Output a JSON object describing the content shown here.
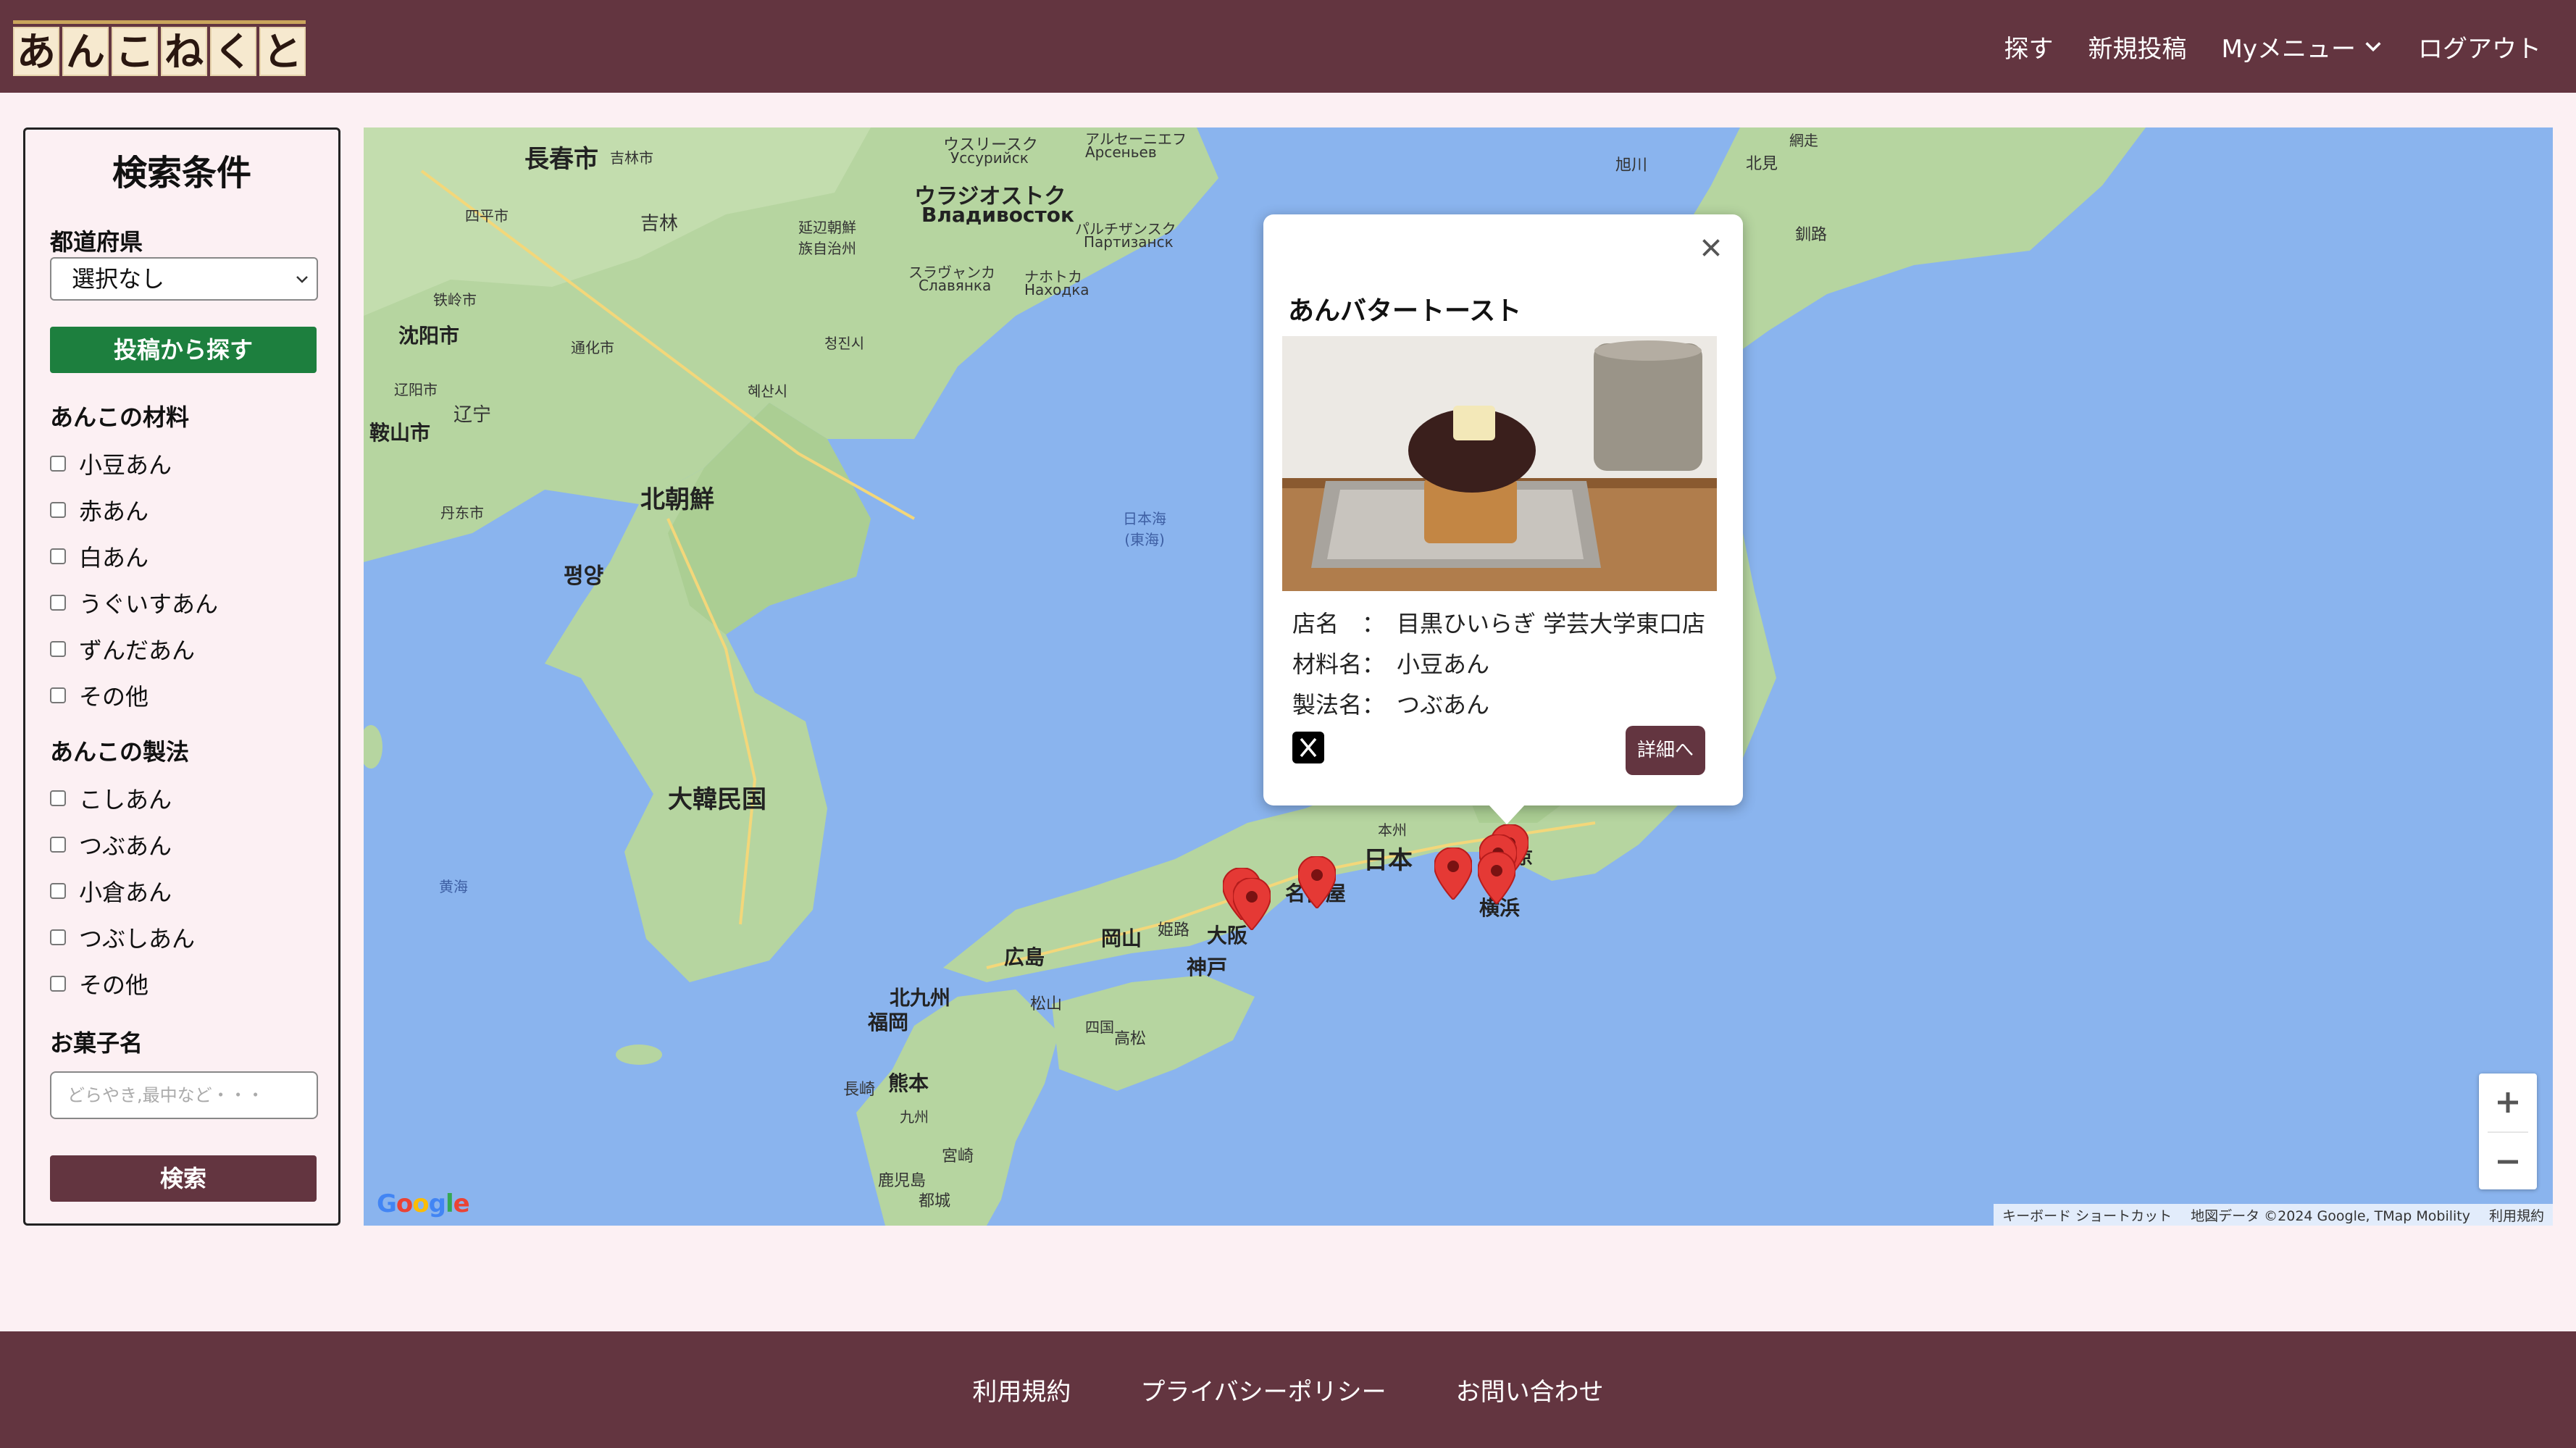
{
  "header": {
    "logo_chars": [
      "あ",
      "ん",
      "こ",
      "ね",
      "く",
      "と"
    ],
    "nav": {
      "search": "探す",
      "new_post": "新規投稿",
      "my_menu": "Myメニュー",
      "logout": "ログアウト"
    }
  },
  "sidebar": {
    "title": "検索条件",
    "prefecture_label": "都道府県",
    "prefecture_value": "選択なし",
    "search_from_posts": "投稿から探す",
    "material_label": "あんこの材料",
    "materials": [
      "小豆あん",
      "赤あん",
      "白あん",
      "うぐいすあん",
      "ずんだあん",
      "その他"
    ],
    "method_label": "あんこの製法",
    "methods": [
      "こしあん",
      "つぶあん",
      "小倉あん",
      "つぶしあん",
      "その他"
    ],
    "sweets_label": "お菓子名",
    "sweets_placeholder": "どらやき,最中など・・・",
    "search_button": "検索"
  },
  "map": {
    "labels": {
      "changchun": "長春市",
      "jilin_city": "吉林市",
      "ussuriysk": "ウスリースク",
      "ussuriysk_ru": "Уссурийск",
      "arsenyev": "アルセーニエフ",
      "arsenyev_ru": "Арсеньев",
      "vladivostok": "ウラジオストク",
      "vladivostok_ru": "Владивосток",
      "partizansk": "パルチザンスク",
      "partizansk_ru": "Партизанск",
      "yanbian": "延辺朝鮮族自治州",
      "siping": "四平市",
      "jilin": "吉林",
      "shenyang": "沈阳市",
      "tieling": "铁岭市",
      "tonghua": "通化市",
      "slavyanka": "スラヴャンカ",
      "slavyanka_ru": "Славянка",
      "nakhodka": "ナホトカ",
      "nakhodka_ru": "Находка",
      "chongjin": "청진시",
      "liaoyang": "辽阳市",
      "liaoning": "辽宁",
      "anshan": "鞍山市",
      "hyesan": "혜산시",
      "dandong": "丹东市",
      "north_korea": "北朝鮮",
      "sea_of_japan": "日本海\n(東海)",
      "pyongyang": "평양",
      "south_korea": "大韓民国",
      "yellow_sea": "黄海",
      "hiroshima": "広島",
      "okayama": "岡山",
      "himeji": "姫路",
      "osaka": "大阪",
      "kobe": "神戸",
      "kitakyushu": "北九州",
      "fukuoka": "福岡",
      "matsuyama": "松山",
      "kochi": "高松",
      "shikoku": "四国",
      "kumamoto": "熊本",
      "nagasaki": "長崎",
      "kyushu": "九州",
      "miyazaki": "宮崎",
      "kagoshima": "鹿児島",
      "miyakonojo": "都城",
      "nagoya": "名古屋",
      "japan": "日本",
      "honshu": "本州",
      "yokohama": "横浜",
      "tokyo": "東京",
      "kushiro": "釧路",
      "asahikawa": "旭川",
      "kitami": "北見",
      "abashiri": "網走"
    },
    "popup": {
      "title": "あんバタートースト",
      "rows": [
        {
          "key": "店名　：",
          "value": "目黒ひいらぎ 学芸大学東口店"
        },
        {
          "key": "材料名：",
          "value": "小豆あん"
        },
        {
          "key": "製法名：",
          "value": "つぶあん"
        }
      ],
      "detail_button": "詳細へ"
    },
    "attribution": {
      "shortcuts": "キーボード ショートカット",
      "data": "地図データ ©2024 Google, TMap Mobility",
      "terms": "利用規約"
    },
    "google": "Google"
  },
  "footer": {
    "terms": "利用規約",
    "privacy": "プライバシーポリシー",
    "contact": "お問い合わせ"
  },
  "colors": {
    "brand": "#633540",
    "green": "#1d7f3e",
    "background": "#fcf0f3",
    "sea": "#8ab4ee",
    "land": "#b7d8a2",
    "pin": "#e53935"
  }
}
